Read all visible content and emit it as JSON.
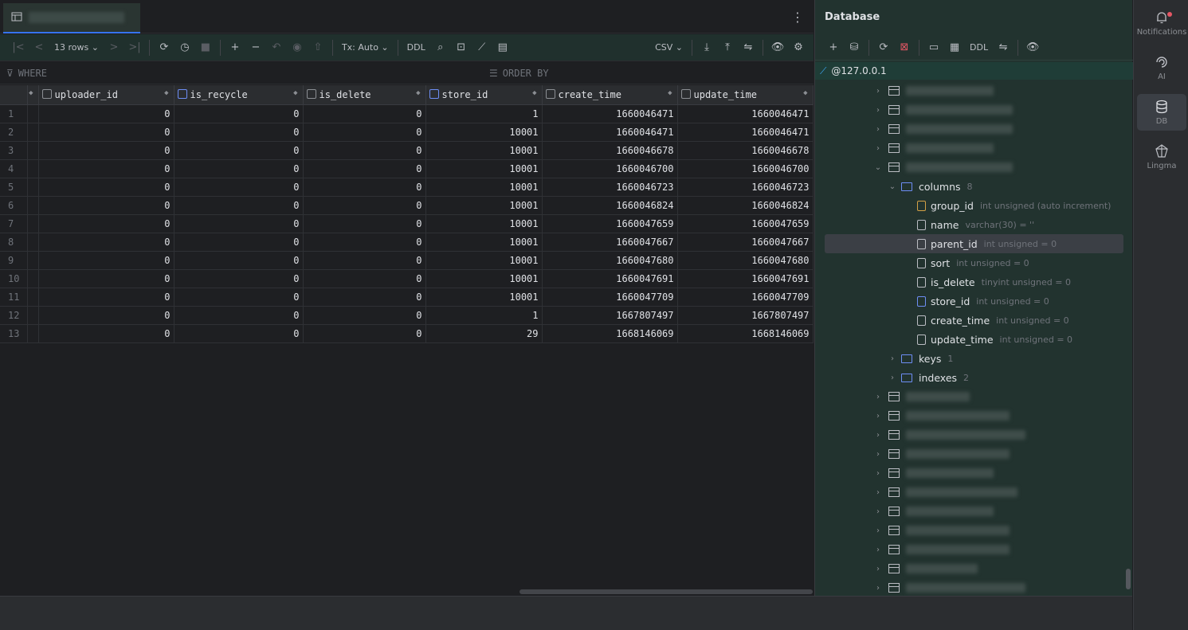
{
  "editor": {
    "tab_more": "⋮",
    "toolbar": {
      "rows_label": "13 rows",
      "tx_label": "Tx: Auto",
      "ddl_label": "DDL",
      "export_format": "CSV"
    },
    "filter": {
      "where_label": "WHERE",
      "orderby_label": "ORDER BY"
    },
    "grid": {
      "columns": [
        "uploader_id",
        "is_recycle",
        "is_delete",
        "store_id",
        "create_time",
        "update_time"
      ],
      "rows": [
        [
          "1",
          "0",
          "0",
          "0",
          "1",
          "1660046471",
          "1660046471"
        ],
        [
          "2",
          "0",
          "0",
          "0",
          "10001",
          "1660046471",
          "1660046471"
        ],
        [
          "3",
          "0",
          "0",
          "0",
          "10001",
          "1660046678",
          "1660046678"
        ],
        [
          "4",
          "0",
          "0",
          "0",
          "10001",
          "1660046700",
          "1660046700"
        ],
        [
          "5",
          "0",
          "0",
          "0",
          "10001",
          "1660046723",
          "1660046723"
        ],
        [
          "6",
          "0",
          "0",
          "0",
          "10001",
          "1660046824",
          "1660046824"
        ],
        [
          "7",
          "0",
          "0",
          "0",
          "10001",
          "1660047659",
          "1660047659"
        ],
        [
          "8",
          "0",
          "0",
          "0",
          "10001",
          "1660047667",
          "1660047667"
        ],
        [
          "9",
          "0",
          "0",
          "0",
          "10001",
          "1660047680",
          "1660047680"
        ],
        [
          "10",
          "0",
          "0",
          "0",
          "10001",
          "1660047691",
          "1660047691"
        ],
        [
          "11",
          "0",
          "0",
          "0",
          "10001",
          "1660047709",
          "1660047709"
        ],
        [
          "12",
          "0",
          "0",
          "0",
          "1",
          "1667807497",
          "1667807497"
        ],
        [
          "13",
          "0",
          "0",
          "0",
          "29",
          "1668146069",
          "1668146069"
        ]
      ]
    }
  },
  "database": {
    "title": "Database",
    "ddl_label": "DDL",
    "connection": "@127.0.0.1",
    "folders": {
      "columns": {
        "label": "columns",
        "count": "8"
      },
      "keys": {
        "label": "keys",
        "count": "1"
      },
      "indexes": {
        "label": "indexes",
        "count": "2"
      }
    },
    "columns": [
      {
        "name": "group_id",
        "type": "int unsigned (auto increment)"
      },
      {
        "name": "name",
        "type": "varchar(30) = ''"
      },
      {
        "name": "parent_id",
        "type": "int unsigned = 0"
      },
      {
        "name": "sort",
        "type": "int unsigned = 0"
      },
      {
        "name": "is_delete",
        "type": "tinyint unsigned = 0"
      },
      {
        "name": "store_id",
        "type": "int unsigned = 0"
      },
      {
        "name": "create_time",
        "type": "int unsigned = 0"
      },
      {
        "name": "update_time",
        "type": "int unsigned = 0"
      }
    ]
  },
  "strip": {
    "notifications": "Notifications",
    "ai": "AI",
    "db": "DB",
    "lingma": "Lingma"
  },
  "colors": {
    "accent": "#3574f0",
    "panel_bg": "#22332f",
    "badge": "#e55765"
  }
}
